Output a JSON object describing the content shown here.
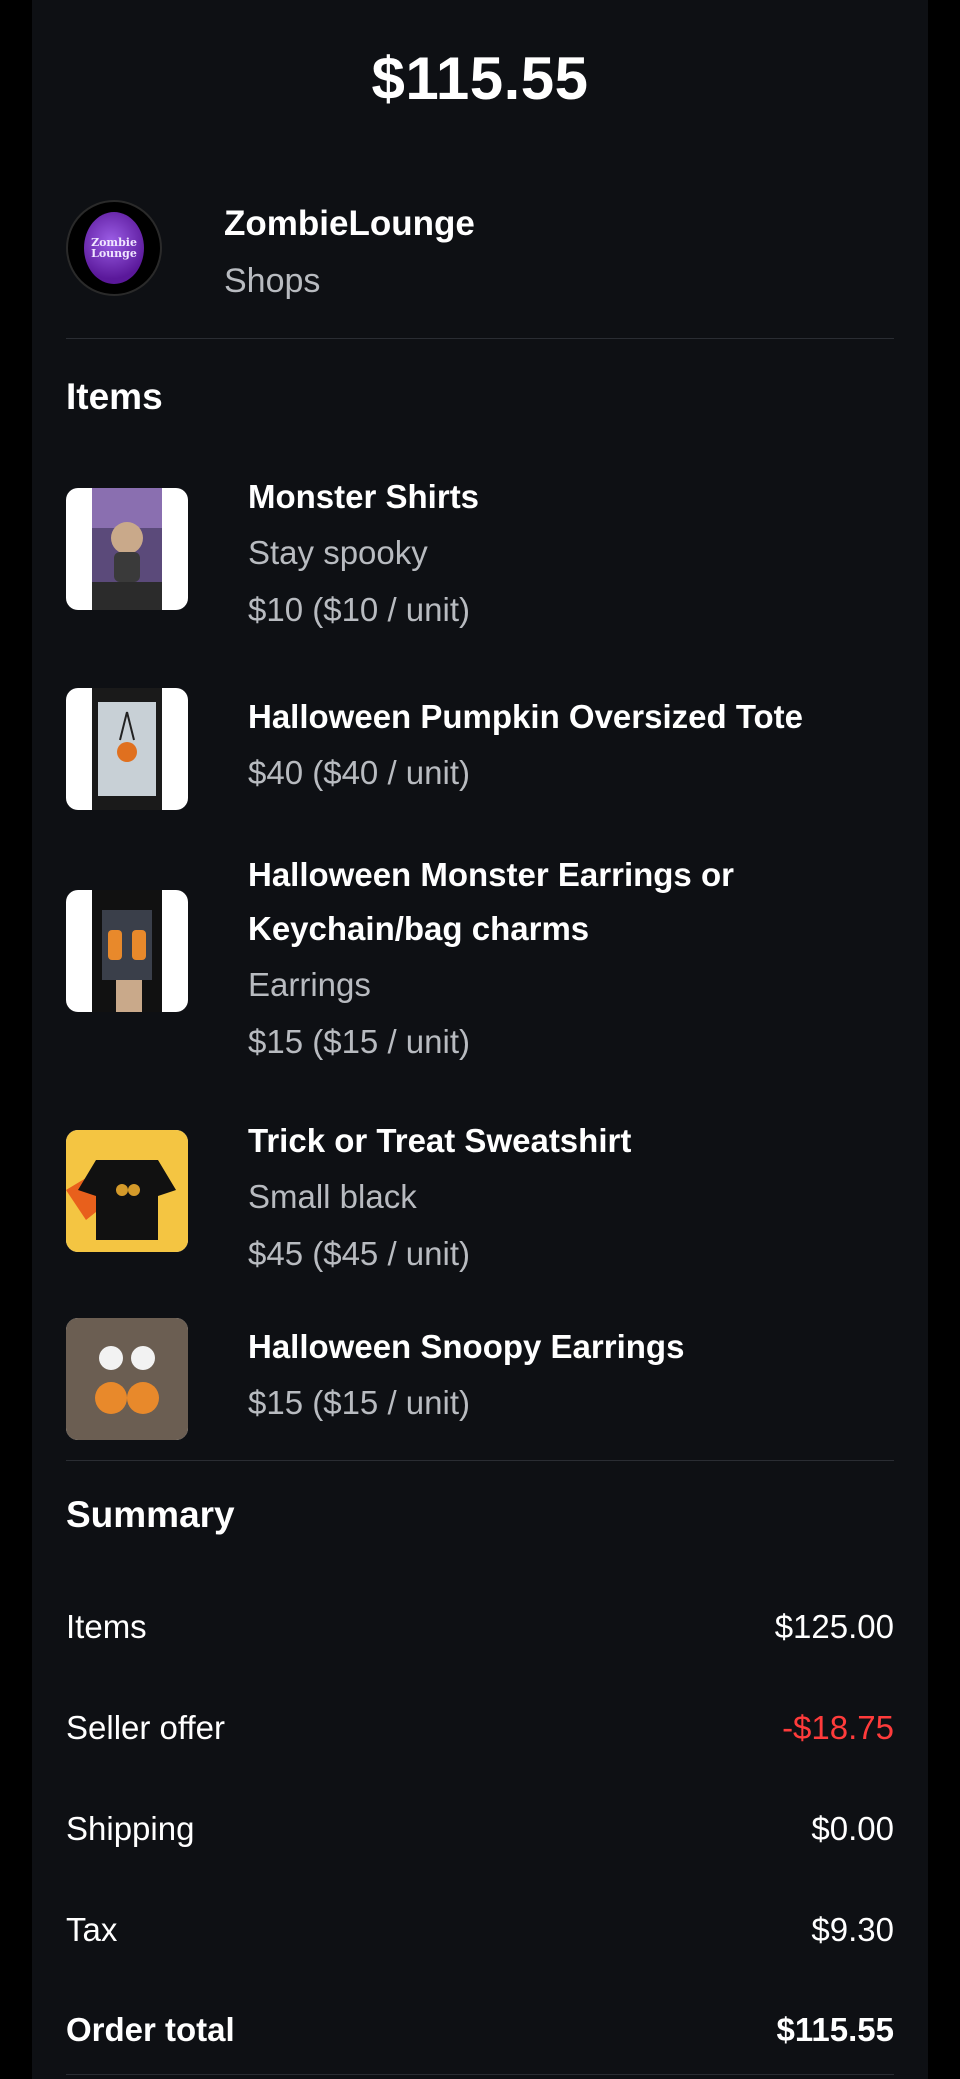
{
  "header": {
    "total": "$115.55"
  },
  "seller": {
    "name": "ZombieLounge",
    "category": "Shops",
    "avatar_text": "Zombie Lounge"
  },
  "items_section": {
    "title": "Items"
  },
  "items": [
    {
      "title": "Monster Shirts",
      "variant": "Stay spooky",
      "price": "$10 ($10 / unit)"
    },
    {
      "title": "Halloween Pumpkin Oversized Tote",
      "price": "$40 ($40 / unit)"
    },
    {
      "title_line1": "Halloween Monster Earrings or",
      "title_line2": "Keychain/bag charms",
      "variant": "Earrings",
      "price": "$15 ($15 / unit)"
    },
    {
      "title": "Trick or Treat Sweatshirt",
      "variant": "Small black",
      "price": "$45 ($45 / unit)"
    },
    {
      "title": "Halloween Snoopy Earrings",
      "price": "$15 ($15 / unit)"
    }
  ],
  "summary": {
    "title": "Summary",
    "items_label": "Items",
    "items_value": "$125.00",
    "offer_label": "Seller offer",
    "offer_value": "-$18.75",
    "shipping_label": "Shipping",
    "shipping_value": "$0.00",
    "tax_label": "Tax",
    "tax_value": "$9.30",
    "total_label": "Order total",
    "total_value": "$115.55"
  },
  "colors": {
    "background": "#0e1014",
    "negative": "#ff3b3b",
    "muted": "#b8bbc0"
  }
}
